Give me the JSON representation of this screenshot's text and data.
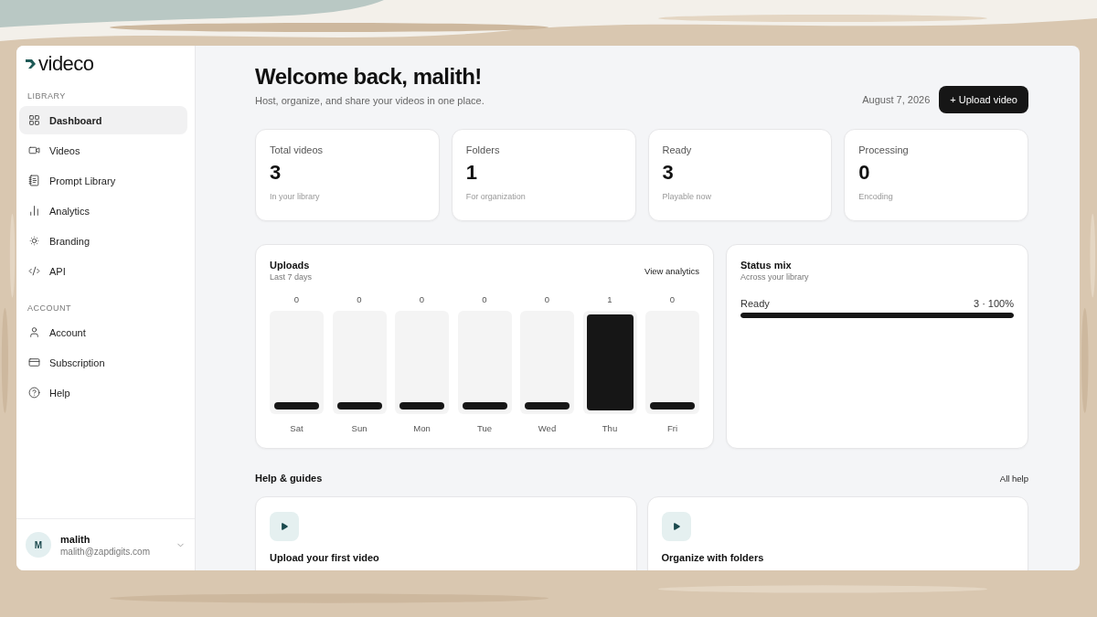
{
  "sidebar": {
    "logo": "videco",
    "sections": [
      {
        "heading": "LIBRARY",
        "items": [
          {
            "label": "Dashboard",
            "selected": true
          },
          {
            "label": "Videos",
            "selected": false
          },
          {
            "label": "Prompt Library",
            "selected": false
          },
          {
            "label": "Analytics",
            "selected": false
          },
          {
            "label": "Branding",
            "selected": false
          },
          {
            "label": "API",
            "selected": false
          }
        ]
      },
      {
        "heading": "ACCOUNT",
        "items": [
          {
            "label": "Account",
            "selected": false
          },
          {
            "label": "Subscription",
            "selected": false
          },
          {
            "label": "Help",
            "selected": false
          }
        ]
      }
    ],
    "user": {
      "initial": "M",
      "name": "malith",
      "email": "malith@zapdigits.com"
    }
  },
  "header": {
    "title": "Welcome back, malith!",
    "subtitle": "Host, organize, and share your videos in one place.",
    "date": "August 7, 2026",
    "button": "+ Upload video"
  },
  "stats": [
    {
      "label": "Total videos",
      "value": "3",
      "note": "In your library"
    },
    {
      "label": "Folders",
      "value": "1",
      "note": "For organization"
    },
    {
      "label": "Ready",
      "value": "3",
      "note": "Playable now"
    },
    {
      "label": "Processing",
      "value": "0",
      "note": "Encoding"
    }
  ],
  "uploads": {
    "title": "Uploads",
    "subtitle": "Last 7 days",
    "link": "View analytics",
    "days": [
      {
        "count": "0",
        "label": "Sat",
        "level": 0
      },
      {
        "count": "0",
        "label": "Sun",
        "level": 0
      },
      {
        "count": "0",
        "label": "Mon",
        "level": 0
      },
      {
        "count": "0",
        "label": "Tue",
        "level": 0
      },
      {
        "count": "0",
        "label": "Wed",
        "level": 0
      },
      {
        "count": "1",
        "label": "Thu",
        "level": 1
      },
      {
        "count": "0",
        "label": "Fri",
        "level": 0
      }
    ]
  },
  "status_mix": {
    "title": "Status mix",
    "subtitle": "Across your library",
    "rows": [
      {
        "label": "Ready",
        "reading": "3 · 100%",
        "level": 1
      }
    ]
  },
  "help": {
    "title": "Help & guides",
    "link": "All help",
    "cards": [
      {
        "title": "Upload your first video"
      },
      {
        "title": "Organize with folders"
      }
    ]
  }
}
